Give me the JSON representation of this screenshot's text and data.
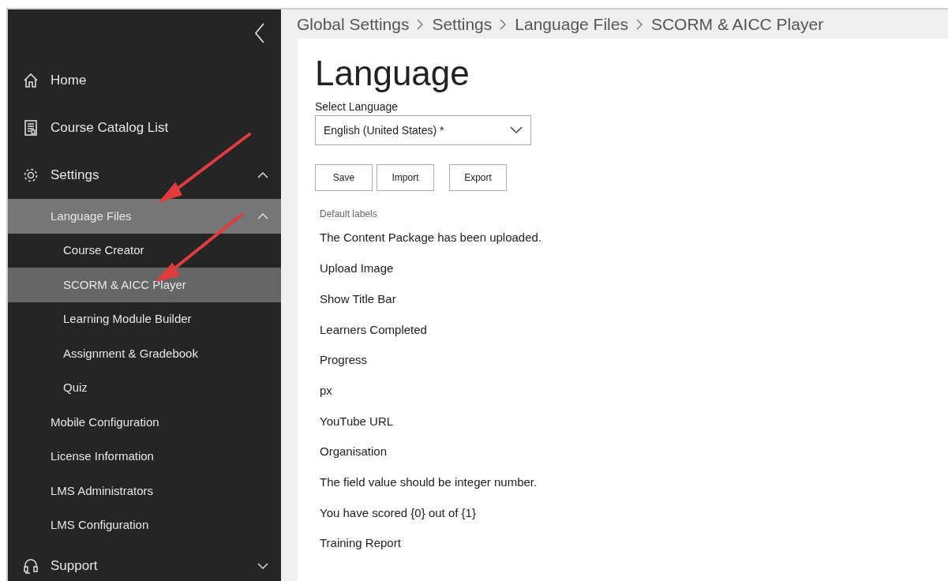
{
  "sidebar": {
    "items": [
      {
        "label": "Home",
        "kind": "top",
        "selected": false
      },
      {
        "label": "Course Catalog List",
        "kind": "top",
        "selected": false
      },
      {
        "label": "Settings",
        "kind": "top",
        "selected": false,
        "expanded": true,
        "children": [
          {
            "label": "Language Files",
            "kind": "group",
            "selected": false,
            "expanded": true,
            "children": [
              {
                "label": "Course Creator",
                "kind": "sub",
                "selected": false
              },
              {
                "label": "SCORM & AICC Player",
                "kind": "sub",
                "selected": true
              },
              {
                "label": "Learning Module Builder",
                "kind": "sub",
                "selected": false
              },
              {
                "label": "Assignment & Gradebook",
                "kind": "sub",
                "selected": false
              },
              {
                "label": "Quiz",
                "kind": "sub",
                "selected": false
              }
            ]
          },
          {
            "label": "Mobile Configuration",
            "kind": "group",
            "selected": false
          },
          {
            "label": "License Information",
            "kind": "group",
            "selected": false
          },
          {
            "label": "LMS Administrators",
            "kind": "group",
            "selected": false
          },
          {
            "label": "LMS Configuration",
            "kind": "group",
            "selected": false
          }
        ]
      },
      {
        "label": "Support",
        "kind": "top",
        "selected": false,
        "expanded": false
      }
    ]
  },
  "breadcrumb": [
    "Global Settings",
    "Settings",
    "Language Files",
    "SCORM & AICC Player"
  ],
  "page": {
    "title": "Language",
    "select_label": "Select Language",
    "select_value": "English (United States) *",
    "buttons": [
      "Save",
      "Import",
      "Export"
    ],
    "labels_heading": "Default labels",
    "labels": [
      "The Content Package has been uploaded.",
      "Upload Image",
      "Show Title Bar",
      "Learners Completed",
      "Progress",
      "px",
      "YouTube URL",
      "Organisation",
      "The field value should be integer number.",
      "You have scored {0} out of {1}",
      "Training Report"
    ]
  }
}
